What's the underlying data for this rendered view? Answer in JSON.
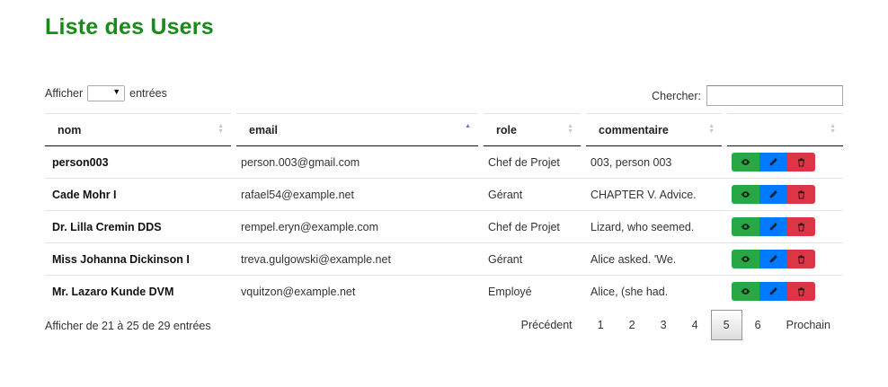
{
  "page": {
    "title": "Liste des Users"
  },
  "length": {
    "label_before": "Afficher",
    "label_after": "entrées",
    "value": ""
  },
  "search": {
    "label": "Chercher:",
    "value": ""
  },
  "table": {
    "columns": [
      "nom",
      "email",
      "role",
      "commentaire",
      ""
    ],
    "rows": [
      {
        "nom": "person003",
        "email": "person.003@gmail.com",
        "role": "Chef de Projet",
        "commentaire": "003, person 003"
      },
      {
        "nom": "Cade Mohr I",
        "email": "rafael54@example.net",
        "role": "Gérant",
        "commentaire": "CHAPTER V. Advice."
      },
      {
        "nom": "Dr. Lilla Cremin DDS",
        "email": "rempel.eryn@example.com",
        "role": "Chef de Projet",
        "commentaire": "Lizard, who seemed."
      },
      {
        "nom": "Miss Johanna Dickinson I",
        "email": "treva.gulgowski@example.net",
        "role": "Gérant",
        "commentaire": "Alice asked. 'We."
      },
      {
        "nom": "Mr. Lazaro Kunde DVM",
        "email": "vquitzon@example.net",
        "role": "Employé",
        "commentaire": "Alice, (she had."
      }
    ],
    "sorted_column": "email",
    "sort_direction": "asc"
  },
  "info": {
    "text": "Afficher de 21 à 25 de 29 entrées"
  },
  "pagination": {
    "previous": "Précédent",
    "pages": [
      "1",
      "2",
      "3",
      "4",
      "5",
      "6"
    ],
    "current": "5",
    "next": "Prochain"
  },
  "colors": {
    "title": "#1a8a1a",
    "view": "#28a745",
    "edit": "#007bff",
    "delete": "#dc3545"
  },
  "icons": {
    "view": "eye-icon",
    "edit": "pencil-icon",
    "delete": "trash-icon"
  }
}
